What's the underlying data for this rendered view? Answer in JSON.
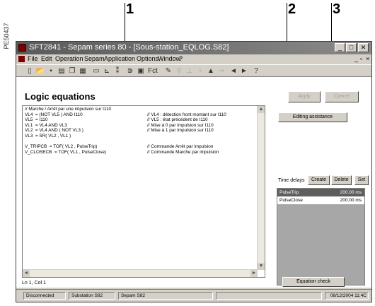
{
  "figure_id": "PE50437",
  "callouts": [
    "1",
    "2",
    "3"
  ],
  "window": {
    "title": "SFT2841 - Sepam series 80 - [Sous-station_EQLOG.S82]",
    "menu": [
      "File",
      "Edit",
      "Operation",
      "Sepam",
      "Application",
      "Options",
      "Window",
      "?"
    ],
    "toolbar_fct": "Fct"
  },
  "main": {
    "title": "Logic equations",
    "code_lines": [
      {
        "code": "// Marche / Arrêt par une impulsion sur I110",
        "comment": ""
      },
      {
        "code": "VL4  = (NOT VL5 ) AND I110",
        "comment": "// VL4 : détection front montant sur I110"
      },
      {
        "code": "VL5  = I110",
        "comment": "// VL5 : état précédent de I110"
      },
      {
        "code": "VL1  = VL4 AND VL3",
        "comment": "// Mise à 0 par impulsion sur I110"
      },
      {
        "code": "VL2  = VL4 AND ( NOT VL3 )",
        "comment": "// Mise à 1 par impulsion sur I110"
      },
      {
        "code": "VL3  = SR( VL2 , VL1 )",
        "comment": ""
      },
      {
        "code": "",
        "comment": ""
      },
      {
        "code": "V_TRIPCB  = TOF( VL2 , PulseTrip)",
        "comment": "// Commande Arrêt par impulsion"
      },
      {
        "code": "V_CLOSECB  = TOF( VL1 , PulseClose)",
        "comment": "// Commande Marche par impulsion"
      }
    ],
    "cursor_position": "Ln 1, Col 1"
  },
  "right_panel": {
    "apply_label": "Apply",
    "cancel_label": "Cancel",
    "editing_assistance_label": "Editing assistance",
    "time_delays_label": "Time delays",
    "create_label": "Create",
    "delete_label": "Delete",
    "set_label": "Set",
    "delays": [
      {
        "name": "PulseTrip",
        "value": "200.00 ms",
        "selected": true
      },
      {
        "name": "PulseClose",
        "value": "200.00 ms",
        "selected": false
      }
    ],
    "equation_check_label": "Equation check"
  },
  "statusbar": {
    "connection": "Disconnected",
    "substation": "Substation S82",
    "sepam": "Sepam S82",
    "datetime": "08/12/2004 11:4C"
  },
  "colors": {
    "window_bg": "#d4d0c8",
    "title_bg": "#6a6a6a",
    "list_bg": "#a7a7a7",
    "selected_row": "#5e5e5e"
  }
}
